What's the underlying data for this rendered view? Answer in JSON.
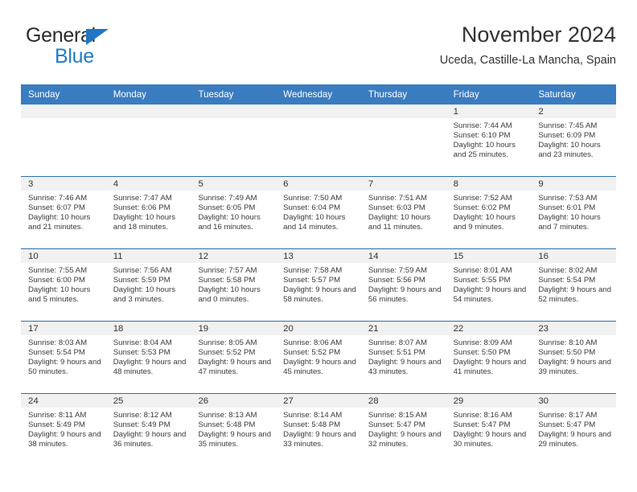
{
  "brand": {
    "name_part1": "General",
    "name_part2": "Blue"
  },
  "header": {
    "title": "November 2024",
    "subtitle": "Uceda, Castille-La Mancha, Spain"
  },
  "colors": {
    "header_blue": "#3a7cc0",
    "row_divider_blue": "#2f6fb0",
    "day_band_gray": "#f1f1f1",
    "brand_blue": "#1f7dc8",
    "text": "#333333"
  },
  "weekdays": [
    "Sunday",
    "Monday",
    "Tuesday",
    "Wednesday",
    "Thursday",
    "Friday",
    "Saturday"
  ],
  "labels": {
    "sunrise": "Sunrise:",
    "sunset": "Sunset:",
    "daylight": "Daylight:"
  },
  "weeks": [
    [
      {
        "day": "",
        "sunrise": "",
        "sunset": "",
        "daylight": "",
        "empty": true
      },
      {
        "day": "",
        "sunrise": "",
        "sunset": "",
        "daylight": "",
        "empty": true
      },
      {
        "day": "",
        "sunrise": "",
        "sunset": "",
        "daylight": "",
        "empty": true
      },
      {
        "day": "",
        "sunrise": "",
        "sunset": "",
        "daylight": "",
        "empty": true
      },
      {
        "day": "",
        "sunrise": "",
        "sunset": "",
        "daylight": "",
        "empty": true
      },
      {
        "day": "1",
        "sunrise": "Sunrise: 7:44 AM",
        "sunset": "Sunset: 6:10 PM",
        "daylight": "Daylight: 10 hours and 25 minutes."
      },
      {
        "day": "2",
        "sunrise": "Sunrise: 7:45 AM",
        "sunset": "Sunset: 6:09 PM",
        "daylight": "Daylight: 10 hours and 23 minutes."
      }
    ],
    [
      {
        "day": "3",
        "sunrise": "Sunrise: 7:46 AM",
        "sunset": "Sunset: 6:07 PM",
        "daylight": "Daylight: 10 hours and 21 minutes."
      },
      {
        "day": "4",
        "sunrise": "Sunrise: 7:47 AM",
        "sunset": "Sunset: 6:06 PM",
        "daylight": "Daylight: 10 hours and 18 minutes."
      },
      {
        "day": "5",
        "sunrise": "Sunrise: 7:49 AM",
        "sunset": "Sunset: 6:05 PM",
        "daylight": "Daylight: 10 hours and 16 minutes."
      },
      {
        "day": "6",
        "sunrise": "Sunrise: 7:50 AM",
        "sunset": "Sunset: 6:04 PM",
        "daylight": "Daylight: 10 hours and 14 minutes."
      },
      {
        "day": "7",
        "sunrise": "Sunrise: 7:51 AM",
        "sunset": "Sunset: 6:03 PM",
        "daylight": "Daylight: 10 hours and 11 minutes."
      },
      {
        "day": "8",
        "sunrise": "Sunrise: 7:52 AM",
        "sunset": "Sunset: 6:02 PM",
        "daylight": "Daylight: 10 hours and 9 minutes."
      },
      {
        "day": "9",
        "sunrise": "Sunrise: 7:53 AM",
        "sunset": "Sunset: 6:01 PM",
        "daylight": "Daylight: 10 hours and 7 minutes."
      }
    ],
    [
      {
        "day": "10",
        "sunrise": "Sunrise: 7:55 AM",
        "sunset": "Sunset: 6:00 PM",
        "daylight": "Daylight: 10 hours and 5 minutes."
      },
      {
        "day": "11",
        "sunrise": "Sunrise: 7:56 AM",
        "sunset": "Sunset: 5:59 PM",
        "daylight": "Daylight: 10 hours and 3 minutes."
      },
      {
        "day": "12",
        "sunrise": "Sunrise: 7:57 AM",
        "sunset": "Sunset: 5:58 PM",
        "daylight": "Daylight: 10 hours and 0 minutes."
      },
      {
        "day": "13",
        "sunrise": "Sunrise: 7:58 AM",
        "sunset": "Sunset: 5:57 PM",
        "daylight": "Daylight: 9 hours and 58 minutes."
      },
      {
        "day": "14",
        "sunrise": "Sunrise: 7:59 AM",
        "sunset": "Sunset: 5:56 PM",
        "daylight": "Daylight: 9 hours and 56 minutes."
      },
      {
        "day": "15",
        "sunrise": "Sunrise: 8:01 AM",
        "sunset": "Sunset: 5:55 PM",
        "daylight": "Daylight: 9 hours and 54 minutes."
      },
      {
        "day": "16",
        "sunrise": "Sunrise: 8:02 AM",
        "sunset": "Sunset: 5:54 PM",
        "daylight": "Daylight: 9 hours and 52 minutes."
      }
    ],
    [
      {
        "day": "17",
        "sunrise": "Sunrise: 8:03 AM",
        "sunset": "Sunset: 5:54 PM",
        "daylight": "Daylight: 9 hours and 50 minutes."
      },
      {
        "day": "18",
        "sunrise": "Sunrise: 8:04 AM",
        "sunset": "Sunset: 5:53 PM",
        "daylight": "Daylight: 9 hours and 48 minutes."
      },
      {
        "day": "19",
        "sunrise": "Sunrise: 8:05 AM",
        "sunset": "Sunset: 5:52 PM",
        "daylight": "Daylight: 9 hours and 47 minutes."
      },
      {
        "day": "20",
        "sunrise": "Sunrise: 8:06 AM",
        "sunset": "Sunset: 5:52 PM",
        "daylight": "Daylight: 9 hours and 45 minutes."
      },
      {
        "day": "21",
        "sunrise": "Sunrise: 8:07 AM",
        "sunset": "Sunset: 5:51 PM",
        "daylight": "Daylight: 9 hours and 43 minutes."
      },
      {
        "day": "22",
        "sunrise": "Sunrise: 8:09 AM",
        "sunset": "Sunset: 5:50 PM",
        "daylight": "Daylight: 9 hours and 41 minutes."
      },
      {
        "day": "23",
        "sunrise": "Sunrise: 8:10 AM",
        "sunset": "Sunset: 5:50 PM",
        "daylight": "Daylight: 9 hours and 39 minutes."
      }
    ],
    [
      {
        "day": "24",
        "sunrise": "Sunrise: 8:11 AM",
        "sunset": "Sunset: 5:49 PM",
        "daylight": "Daylight: 9 hours and 38 minutes."
      },
      {
        "day": "25",
        "sunrise": "Sunrise: 8:12 AM",
        "sunset": "Sunset: 5:49 PM",
        "daylight": "Daylight: 9 hours and 36 minutes."
      },
      {
        "day": "26",
        "sunrise": "Sunrise: 8:13 AM",
        "sunset": "Sunset: 5:48 PM",
        "daylight": "Daylight: 9 hours and 35 minutes."
      },
      {
        "day": "27",
        "sunrise": "Sunrise: 8:14 AM",
        "sunset": "Sunset: 5:48 PM",
        "daylight": "Daylight: 9 hours and 33 minutes."
      },
      {
        "day": "28",
        "sunrise": "Sunrise: 8:15 AM",
        "sunset": "Sunset: 5:47 PM",
        "daylight": "Daylight: 9 hours and 32 minutes."
      },
      {
        "day": "29",
        "sunrise": "Sunrise: 8:16 AM",
        "sunset": "Sunset: 5:47 PM",
        "daylight": "Daylight: 9 hours and 30 minutes."
      },
      {
        "day": "30",
        "sunrise": "Sunrise: 8:17 AM",
        "sunset": "Sunset: 5:47 PM",
        "daylight": "Daylight: 9 hours and 29 minutes."
      }
    ]
  ]
}
